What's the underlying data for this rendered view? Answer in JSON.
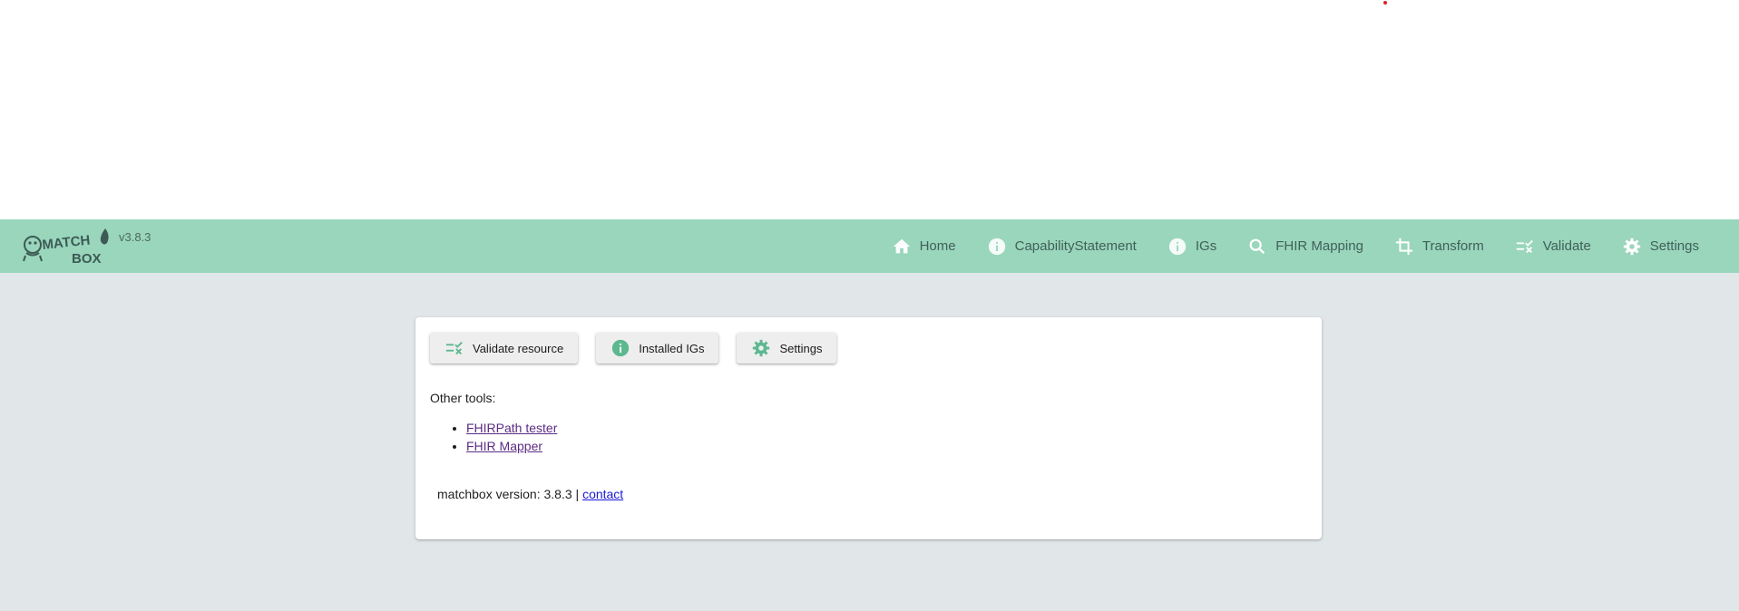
{
  "app": {
    "brand_line1": "MATCH",
    "brand_line2": "BOX",
    "version": "v3.8.3"
  },
  "nav": {
    "items": [
      {
        "label": "Home",
        "icon": "home-icon"
      },
      {
        "label": "CapabilityStatement",
        "icon": "info-icon"
      },
      {
        "label": "IGs",
        "icon": "info-icon"
      },
      {
        "label": "FHIR Mapping",
        "icon": "search-icon"
      },
      {
        "label": "Transform",
        "icon": "crop-icon"
      },
      {
        "label": "Validate",
        "icon": "validate-checklist-icon"
      },
      {
        "label": "Settings",
        "icon": "gear-icon"
      }
    ]
  },
  "main": {
    "buttons": [
      {
        "label": "Validate resource",
        "icon": "validate-checklist-icon"
      },
      {
        "label": "Installed IGs",
        "icon": "info-icon"
      },
      {
        "label": "Settings",
        "icon": "gear-icon"
      }
    ],
    "other_tools_label": "Other tools:",
    "tools": [
      {
        "label": "FHIRPath tester"
      },
      {
        "label": "FHIR Mapper"
      }
    ],
    "footer_text": "matchbox version: 3.8.3 | ",
    "footer_link": "contact"
  },
  "colors": {
    "navbar": "#99d6bc",
    "nav_text": "#41605a",
    "accent_green": "#5cb88e",
    "content_bg": "#e1e6e8",
    "visited_link": "#5c2b84",
    "link": "#1a1ad6"
  }
}
